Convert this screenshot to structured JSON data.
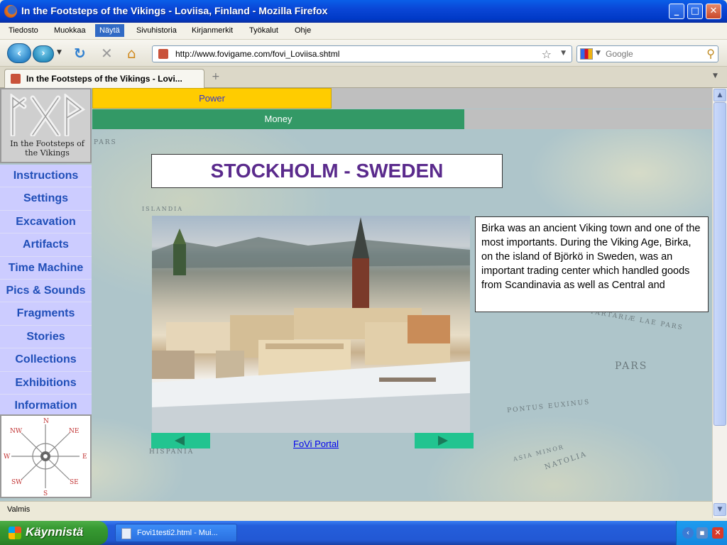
{
  "window": {
    "title": "In the Footsteps of the Vikings - Loviisa, Finland - Mozilla Firefox"
  },
  "menu": [
    "Tiedosto",
    "Muokkaa",
    "Näytä",
    "Sivuhistoria",
    "Kirjanmerkit",
    "Työkalut",
    "Ohje"
  ],
  "address": {
    "url": "http://www.fovigame.com/fovi_Loviisa.shtml"
  },
  "search": {
    "placeholder": "Google"
  },
  "tab": {
    "label": "In the Footsteps of the Vikings - Lovi..."
  },
  "game": {
    "power_label": "Power",
    "power_level": 0.384,
    "money_label": "Money",
    "money_level": 0.601,
    "logo_text": "In the Footsteps of the Vikings",
    "nav": [
      "Instructions",
      "Settings",
      "Excavation",
      "Artifacts",
      "Time Machine",
      "Pics & Sounds",
      "Fragments",
      "Stories",
      "Collections",
      "Exhibitions",
      "Information"
    ],
    "compass_labels": [
      "N",
      "NW",
      "NE",
      "W",
      "E",
      "SW",
      "SE",
      "S"
    ],
    "location_title": "STOCKHOLM - SWEDEN",
    "description": "Birka was an ancient Viking town and one of the most importants. During the Viking Age, Birka, on the island of Björkö in Sweden, was an important trading center which handled goods from Scandinavia as well as Central and",
    "portal_link": "FoVi Portal",
    "map_labels": [
      "PARS",
      "ISLANDIA",
      "PONTUS EUXINUS",
      "TARTARIÆ LAE PARS",
      "ASIA MINOR",
      "NATOLIA",
      "HISPANIA"
    ]
  },
  "status": {
    "text": "Valmis"
  },
  "taskbar": {
    "start_label": "Käynnistä",
    "item_label": "Fovi1testi2.html - Mui..."
  },
  "colors": {
    "power_bar": "#FFCC00",
    "money_bar": "#339966",
    "nav_bg": "#CCCCFF",
    "nav_text": "#1F4EB8",
    "heading": "#5A2A8C",
    "arrow_button": "#22C490"
  }
}
